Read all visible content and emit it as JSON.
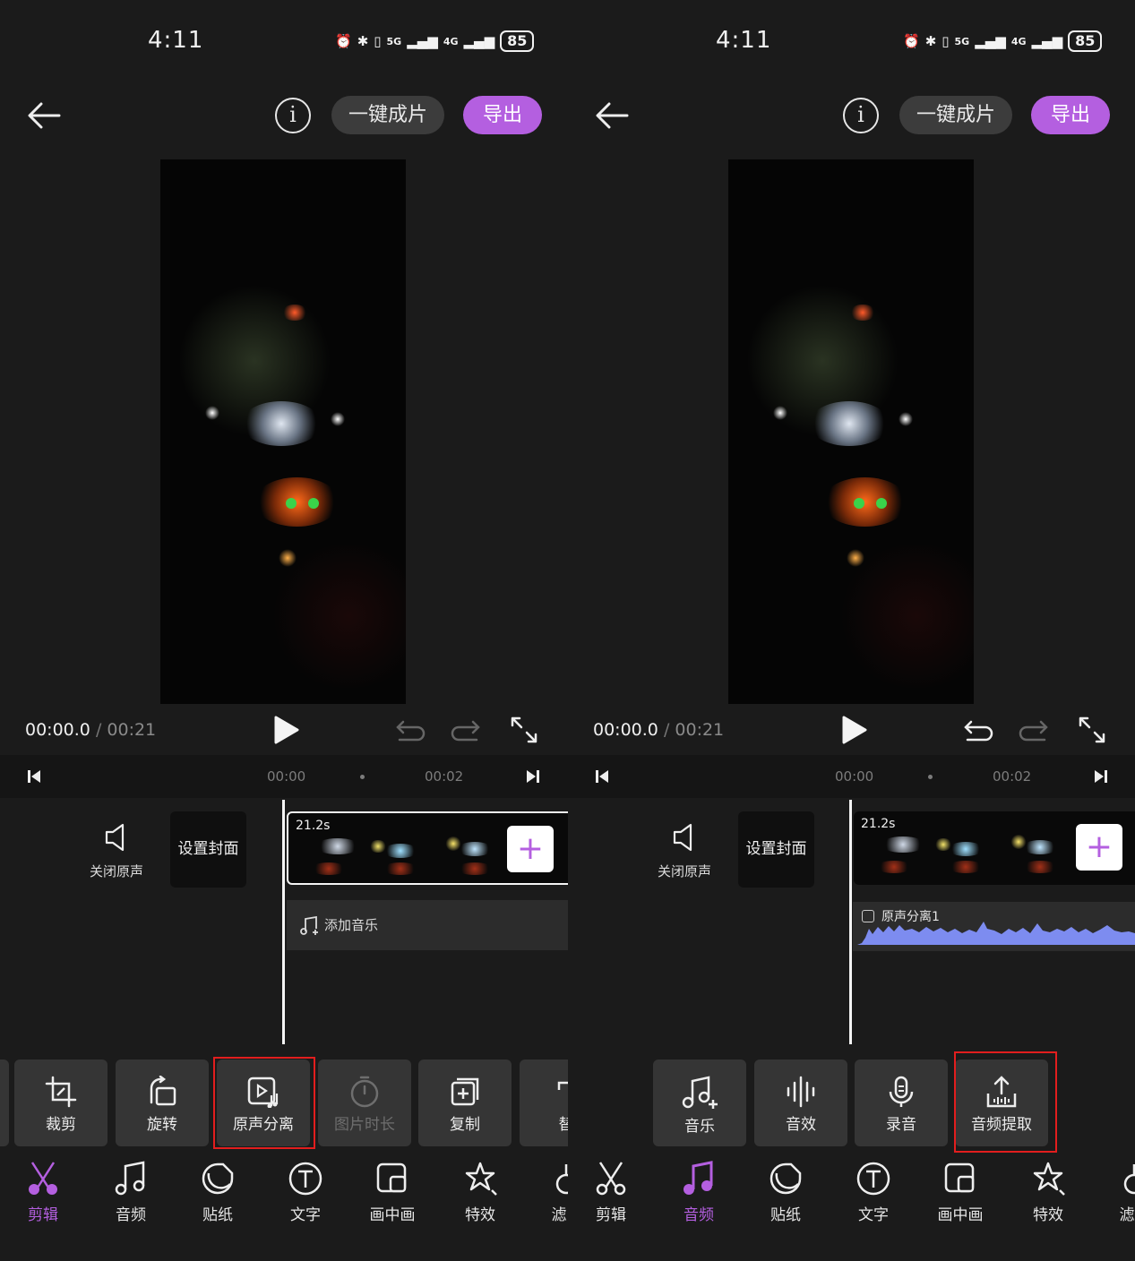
{
  "accent_color": "#b45fe0",
  "status_bar": {
    "time": "4:11",
    "network_5g": "5G",
    "network_4g": "4G",
    "battery": "85"
  },
  "header": {
    "oneclick_label": "一键成片",
    "export_label": "导出"
  },
  "playback": {
    "current_time": "00:00.0",
    "separator": "/",
    "total_time": "00:21"
  },
  "timeline": {
    "tick_start": "00:00",
    "tick_end": "00:02",
    "mute_label": "关闭原声",
    "cover_label": "设置封面",
    "clip_duration": "21.2s",
    "add_music_label": "添加音乐",
    "audio_track_label": "原声分离1"
  },
  "left_tools": [
    {
      "label": "裁剪",
      "icon": "crop-icon"
    },
    {
      "label": "旋转",
      "icon": "rotate-icon"
    },
    {
      "label": "原声分离",
      "icon": "audio-separate-icon"
    },
    {
      "label": "图片时长",
      "icon": "stopwatch-icon"
    },
    {
      "label": "复制",
      "icon": "copy-icon"
    },
    {
      "label": "替",
      "icon": "replace-icon"
    }
  ],
  "right_tools": [
    {
      "label": "音乐",
      "icon": "music-add-icon"
    },
    {
      "label": "音效",
      "icon": "sound-effect-icon"
    },
    {
      "label": "录音",
      "icon": "microphone-icon"
    },
    {
      "label": "音频提取",
      "icon": "audio-extract-icon"
    }
  ],
  "nav": [
    {
      "label": "剪辑",
      "icon": "scissors-icon"
    },
    {
      "label": "音频",
      "icon": "music-note-icon"
    },
    {
      "label": "贴纸",
      "icon": "sticker-icon"
    },
    {
      "label": "文字",
      "icon": "text-icon"
    },
    {
      "label": "画中画",
      "icon": "picture-in-picture-icon"
    },
    {
      "label": "特效",
      "icon": "effects-icon"
    },
    {
      "label": "滤",
      "icon": "filter-icon"
    }
  ],
  "left_panel": {
    "active_nav": "剪辑",
    "highlighted_tool": "原声分离"
  },
  "right_panel": {
    "active_nav": "音频",
    "highlighted_tool": "音频提取"
  }
}
